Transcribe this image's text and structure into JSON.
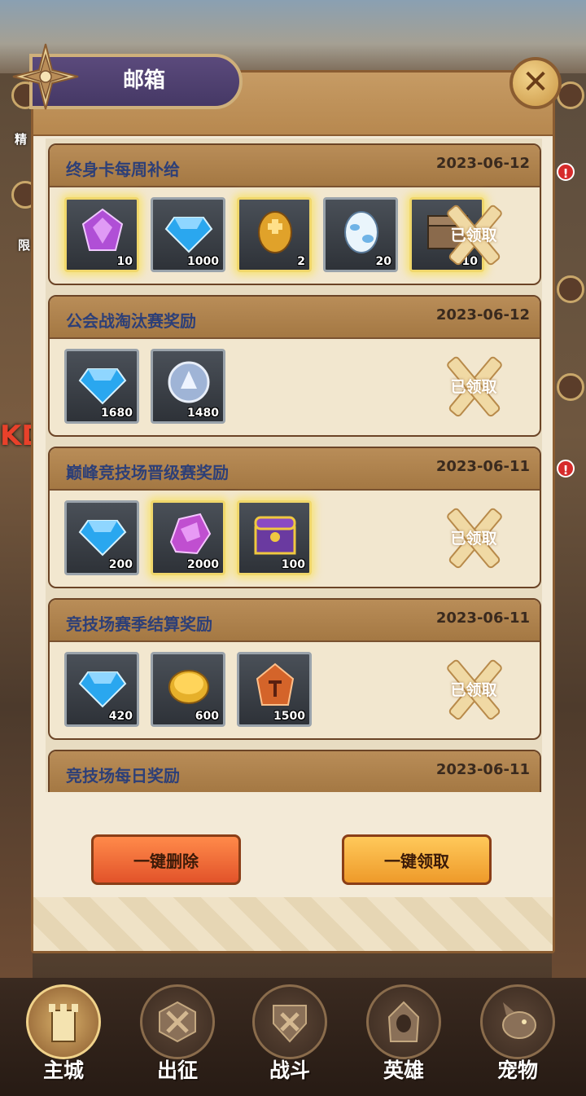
{
  "dialog": {
    "title": "邮箱",
    "close_glyph": "✕",
    "delete_all_label": "一键删除",
    "claim_all_label": "一键领取"
  },
  "mails": [
    {
      "title": "终身卡每周补给",
      "date": "2023-06-12",
      "claimed_label": "已领取",
      "items": [
        {
          "icon": "purple-crystal-icon",
          "count": "10",
          "highlight": true,
          "color": "#b04fd6"
        },
        {
          "icon": "blue-diamond-icon",
          "count": "1000",
          "highlight": false,
          "color": "#2aa7ef"
        },
        {
          "icon": "golden-egg-icon",
          "count": "2",
          "highlight": true,
          "color": "#e0a22a"
        },
        {
          "icon": "spotted-egg-icon",
          "count": "20",
          "highlight": false,
          "color": "#cfe7f7"
        },
        {
          "icon": "chest-icon",
          "count": "10",
          "highlight": true,
          "color": "#a08060"
        }
      ]
    },
    {
      "title": "公会战淘汰赛奖励",
      "date": "2023-06-12",
      "claimed_label": "已领取",
      "items": [
        {
          "icon": "blue-diamond-icon",
          "count": "1680",
          "highlight": false,
          "color": "#2aa7ef"
        },
        {
          "icon": "silver-coin-icon",
          "count": "1480",
          "highlight": false,
          "color": "#9fb4d6"
        }
      ]
    },
    {
      "title": "巅峰竞技场晋级赛奖励",
      "date": "2023-06-11",
      "claimed_label": "已领取",
      "items": [
        {
          "icon": "blue-diamond-icon",
          "count": "200",
          "highlight": false,
          "color": "#2aa7ef"
        },
        {
          "icon": "purple-ore-icon",
          "count": "2000",
          "highlight": true,
          "color": "#c04fd0"
        },
        {
          "icon": "purple-chest-icon",
          "count": "100",
          "highlight": true,
          "color": "#6a3aa0"
        }
      ]
    },
    {
      "title": "竞技场赛季结算奖励",
      "date": "2023-06-11",
      "claimed_label": "已领取",
      "items": [
        {
          "icon": "blue-diamond-icon",
          "count": "420",
          "highlight": false,
          "color": "#2aa7ef"
        },
        {
          "icon": "gold-coin-icon",
          "count": "600",
          "highlight": false,
          "color": "#e6b02a"
        },
        {
          "icon": "rune-stone-icon",
          "count": "1500",
          "highlight": false,
          "color": "#d4642a"
        }
      ]
    },
    {
      "title": "竞技场每日奖励",
      "date": "2023-06-11"
    }
  ],
  "side": {
    "left_label_1": "精",
    "left_label_2": "限",
    "banner_text": "KD",
    "badge": "!"
  },
  "nav": [
    {
      "label": "主城",
      "icon": "castle-icon",
      "active": true
    },
    {
      "label": "出征",
      "icon": "expedition-icon",
      "active": false
    },
    {
      "label": "战斗",
      "icon": "battle-icon",
      "active": false
    },
    {
      "label": "英雄",
      "icon": "hero-icon",
      "active": false
    },
    {
      "label": "宠物",
      "icon": "pet-icon",
      "active": false
    }
  ]
}
